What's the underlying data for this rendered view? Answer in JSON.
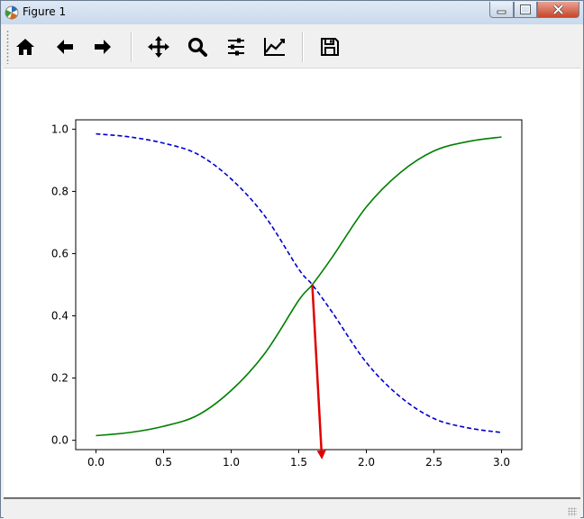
{
  "window": {
    "title": "Figure 1"
  },
  "toolbar": {
    "tools": [
      {
        "name": "home-icon",
        "tip": "Home"
      },
      {
        "name": "back-icon",
        "tip": "Back"
      },
      {
        "name": "forward-icon",
        "tip": "Forward"
      },
      {
        "name": "pan-icon",
        "tip": "Pan"
      },
      {
        "name": "zoom-icon",
        "tip": "Zoom"
      },
      {
        "name": "subplots-icon",
        "tip": "Subplots"
      },
      {
        "name": "customize-icon",
        "tip": "Customize"
      },
      {
        "name": "save-icon",
        "tip": "Save"
      }
    ]
  },
  "chart_data": {
    "type": "line",
    "title": "",
    "xlabel": "",
    "ylabel": "",
    "xlim": [
      -0.15,
      3.15
    ],
    "ylim": [
      -0.03,
      1.03
    ],
    "xticks": [
      "0.0",
      "0.5",
      "1.0",
      "1.5",
      "2.0",
      "2.5",
      "3.0"
    ],
    "yticks": [
      "0.0",
      "0.2",
      "0.4",
      "0.6",
      "0.8",
      "1.0"
    ],
    "grid": false,
    "series": [
      {
        "style": "dashed",
        "color": "#0000cc",
        "x": [
          0,
          0.25,
          0.5,
          0.75,
          1.0,
          1.25,
          1.5,
          1.6,
          1.75,
          2.0,
          2.25,
          2.5,
          2.75,
          3.0
        ],
        "values": [
          0.985,
          0.975,
          0.955,
          0.92,
          0.84,
          0.72,
          0.55,
          0.5,
          0.41,
          0.25,
          0.14,
          0.07,
          0.04,
          0.025
        ]
      },
      {
        "style": "solid",
        "color": "#007f00",
        "x": [
          0,
          0.25,
          0.5,
          0.75,
          1.0,
          1.25,
          1.5,
          1.6,
          1.75,
          2.0,
          2.25,
          2.5,
          2.75,
          3.0
        ],
        "values": [
          0.015,
          0.025,
          0.045,
          0.08,
          0.16,
          0.28,
          0.45,
          0.5,
          0.59,
          0.75,
          0.86,
          0.93,
          0.96,
          0.975
        ]
      }
    ],
    "annotations": [
      {
        "type": "arrow",
        "color": "#e00000",
        "from": [
          1.6,
          0.5
        ],
        "to": [
          1.67,
          -0.05
        ]
      }
    ]
  }
}
